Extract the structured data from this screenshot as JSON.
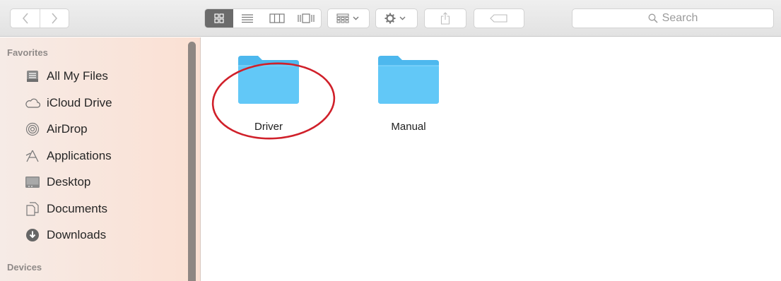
{
  "toolbar": {
    "back_icon": "chevron-left-icon",
    "forward_icon": "chevron-right-icon",
    "view_modes": [
      "icon-view",
      "list-view",
      "column-view",
      "cover-flow-view"
    ],
    "search_placeholder": "Search"
  },
  "sidebar": {
    "favorites_title": "Favorites",
    "items": [
      {
        "label": "All My Files",
        "icon": "all-files-icon"
      },
      {
        "label": "iCloud Drive",
        "icon": "cloud-icon"
      },
      {
        "label": "AirDrop",
        "icon": "airdrop-icon"
      },
      {
        "label": "Applications",
        "icon": "applications-icon"
      },
      {
        "label": "Desktop",
        "icon": "desktop-icon"
      },
      {
        "label": "Documents",
        "icon": "documents-icon"
      },
      {
        "label": "Downloads",
        "icon": "downloads-icon"
      }
    ],
    "devices_title": "Devices"
  },
  "content": {
    "files": [
      {
        "name": "Driver",
        "highlighted": true
      },
      {
        "name": "Manual",
        "highlighted": false
      }
    ]
  },
  "colors": {
    "folder": "#5cc4f5",
    "highlight_ring": "#d0202a",
    "sidebar_bg": "#f9e4da"
  }
}
